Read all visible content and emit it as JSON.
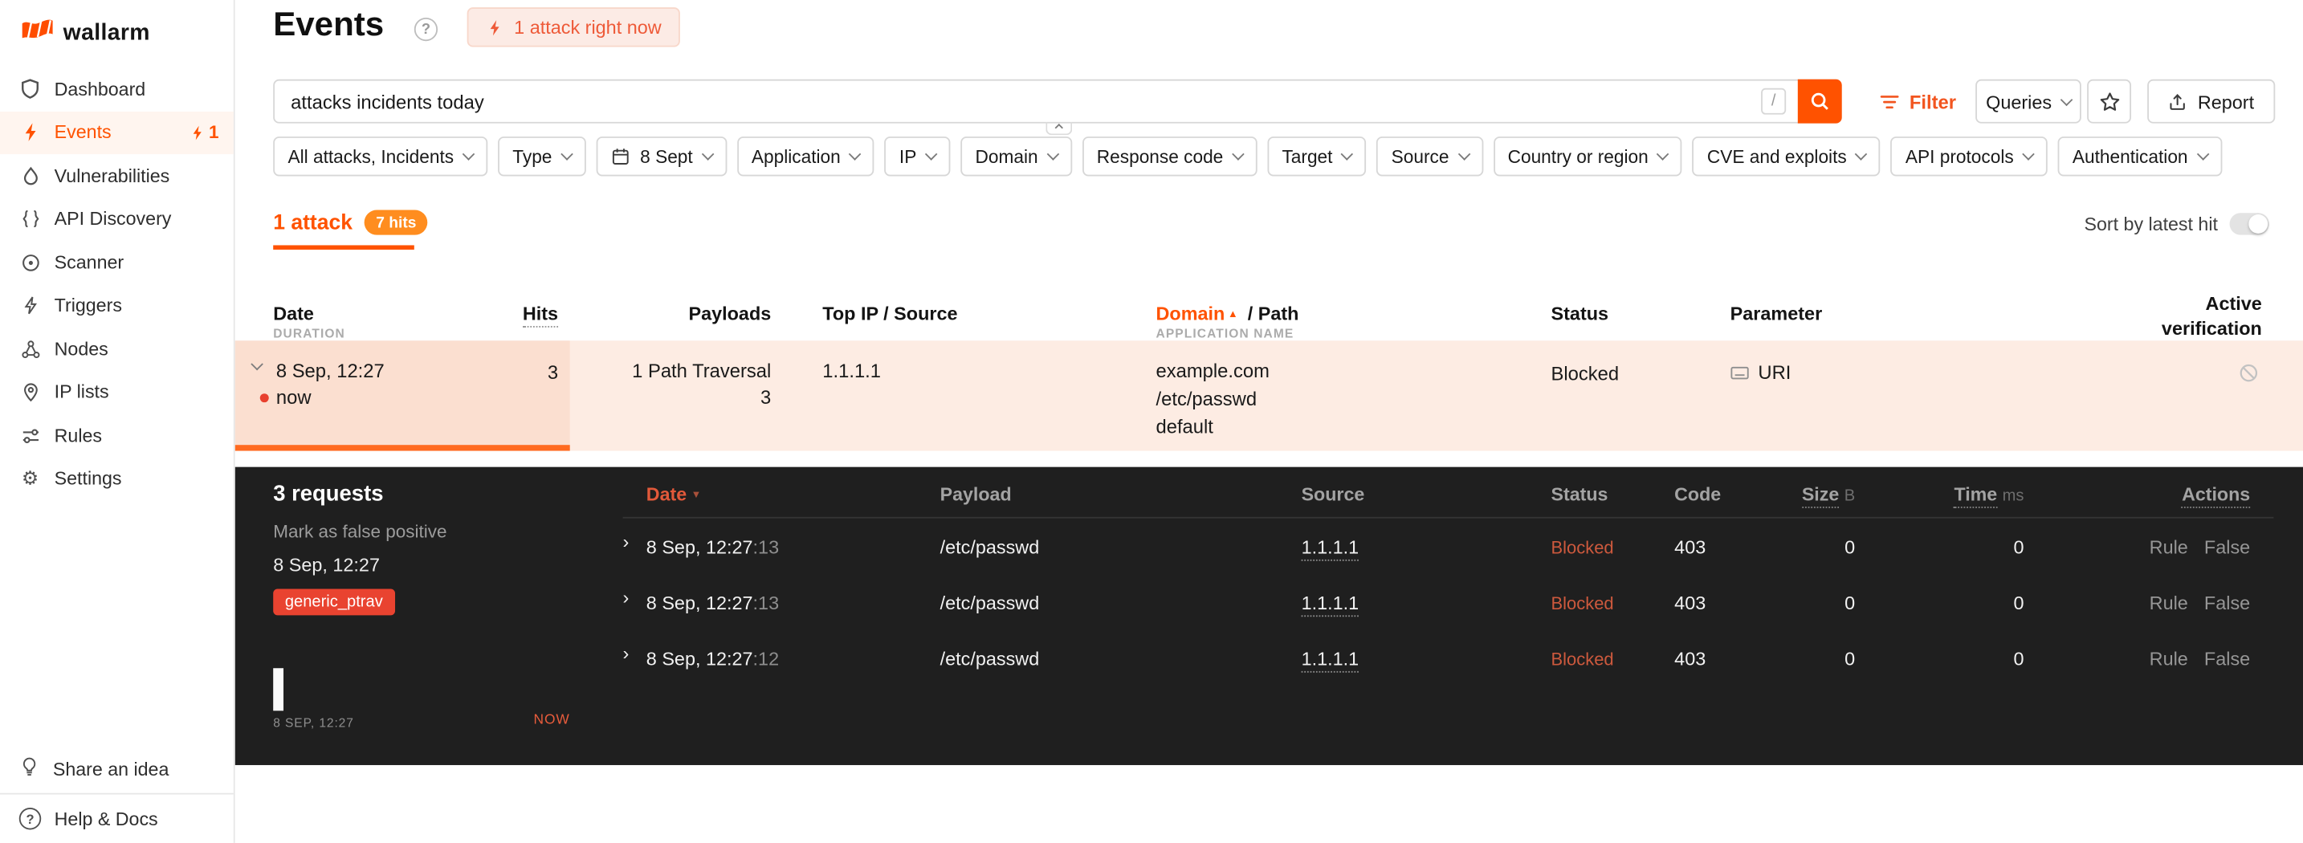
{
  "colors": {
    "accent": "#ff5200",
    "blocked_light": "#e25a3a",
    "blocked_dark": "#cd593d",
    "panel_bg": "#1f1f1f",
    "tag_red": "#e94330"
  },
  "brand": {
    "name": "wallarm"
  },
  "sidebar": {
    "items": [
      {
        "label": "Dashboard"
      },
      {
        "label": "Events",
        "badge": "1"
      },
      {
        "label": "Vulnerabilities"
      },
      {
        "label": "API Discovery"
      },
      {
        "label": "Scanner"
      },
      {
        "label": "Triggers"
      },
      {
        "label": "Nodes"
      },
      {
        "label": "IP lists"
      },
      {
        "label": "Rules"
      },
      {
        "label": "Settings"
      }
    ],
    "footer": [
      {
        "label": "Share an idea"
      },
      {
        "label": "Help & Docs"
      }
    ]
  },
  "header": {
    "title": "Events",
    "help": "?",
    "alert": "1 attack right now"
  },
  "toolbar": {
    "search_value": "attacks incidents today",
    "shortcut": "/",
    "filter": "Filter",
    "queries": "Queries",
    "report": "Report"
  },
  "filters": [
    "All attacks, Incidents",
    "Type",
    "8 Sept",
    "Application",
    "IP",
    "Domain",
    "Response code",
    "Target",
    "Source",
    "Country or region",
    "CVE and exploits",
    "API protocols",
    "Authentication"
  ],
  "tabs": {
    "attack": "1 attack",
    "hits": "7 hits",
    "sort": "Sort by latest hit"
  },
  "table": {
    "headers": {
      "date": "Date",
      "duration": "DURATION",
      "hits": "Hits",
      "payloads": "Payloads",
      "top_ip": "Top IP / Source",
      "domain": "Domain",
      "path": "/ Path",
      "application": "APPLICATION NAME",
      "status": "Status",
      "parameter": "Parameter",
      "active_verification": "Active verification"
    },
    "row": {
      "date": "8 Sep, 12:27",
      "duration": "now",
      "hits": "3",
      "payload": "1 Path Traversal",
      "payload_count": "3",
      "top_ip": "1.1.1.1",
      "domain": "example.com",
      "path": "/etc/passwd",
      "application": "default",
      "status": "Blocked",
      "parameter": "URI"
    }
  },
  "details": {
    "requests": "3 requests",
    "false_positive": "Mark as false positive",
    "date": "8 Sep, 12:27",
    "tag": "generic_ptrav",
    "timeline_start": "8 SEP, 12:27",
    "timeline_end": "NOW",
    "headers": {
      "date": "Date",
      "payload": "Payload",
      "source": "Source",
      "status": "Status",
      "code": "Code",
      "size": "Size",
      "size_unit": "B",
      "time": "Time",
      "time_unit": "ms",
      "actions": "Actions"
    },
    "rows": [
      {
        "date": "8 Sep, 12:27",
        "seconds": ":13",
        "payload": "/etc/passwd",
        "source": "1.1.1.1",
        "status": "Blocked",
        "code": "403",
        "size": "0",
        "time": "0",
        "rule": "Rule",
        "fp": "False"
      },
      {
        "date": "8 Sep, 12:27",
        "seconds": ":13",
        "payload": "/etc/passwd",
        "source": "1.1.1.1",
        "status": "Blocked",
        "code": "403",
        "size": "0",
        "time": "0",
        "rule": "Rule",
        "fp": "False"
      },
      {
        "date": "8 Sep, 12:27",
        "seconds": ":12",
        "payload": "/etc/passwd",
        "source": "1.1.1.1",
        "status": "Blocked",
        "code": "403",
        "size": "0",
        "time": "0",
        "rule": "Rule",
        "fp": "False"
      }
    ]
  }
}
